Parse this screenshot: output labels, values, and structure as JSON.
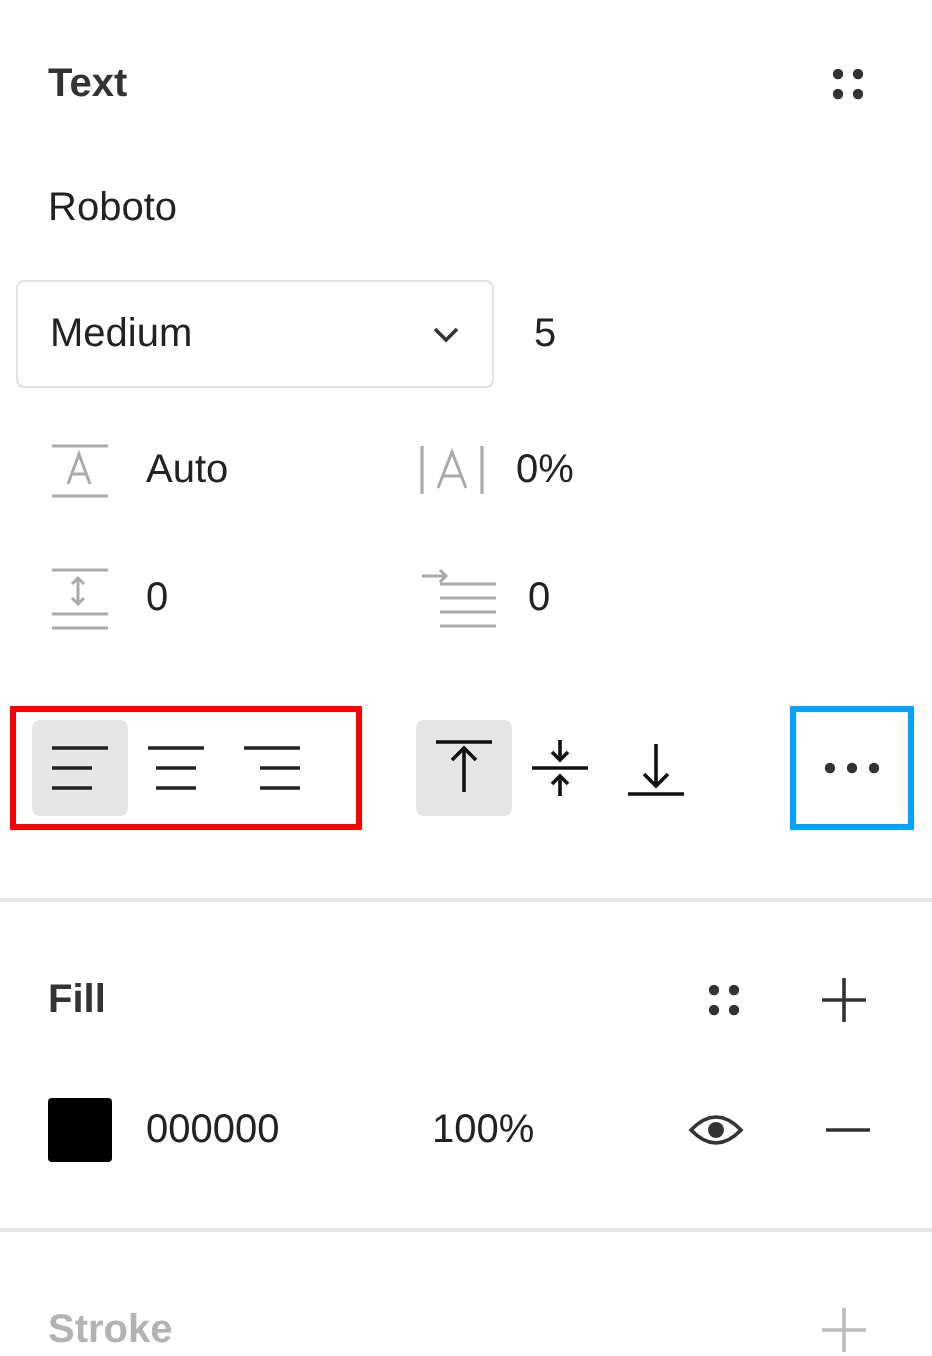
{
  "section": {
    "title": "Text"
  },
  "font_family": "Roboto",
  "font_weight": {
    "value": "Medium"
  },
  "font_size": "5",
  "metrics": [
    {
      "kind": "line-height",
      "value": "Auto"
    },
    {
      "kind": "letter-spacing",
      "value": "0%"
    },
    {
      "kind": "paragraph-spacing",
      "value": "0"
    },
    {
      "kind": "paragraph-indent",
      "value": "0"
    }
  ],
  "horizontal_align": {
    "highlighted": true,
    "color": "#ff0000",
    "options": [
      {
        "kind": "left",
        "selected": true
      },
      {
        "kind": "center",
        "selected": false
      },
      {
        "kind": "right",
        "selected": false
      }
    ]
  },
  "vertical_align": [
    {
      "kind": "top",
      "selected": true
    },
    {
      "kind": "middle",
      "selected": false
    },
    {
      "kind": "bottom",
      "selected": false
    }
  ],
  "more_button": {
    "highlighted": true,
    "color": "#00a3ff"
  },
  "fill": {
    "title": "Fill",
    "items": [
      {
        "color": "#000000",
        "hex": "000000",
        "opacity": "100%",
        "visible": true
      }
    ]
  },
  "stroke": {
    "title": "Stroke",
    "disabled": true
  }
}
